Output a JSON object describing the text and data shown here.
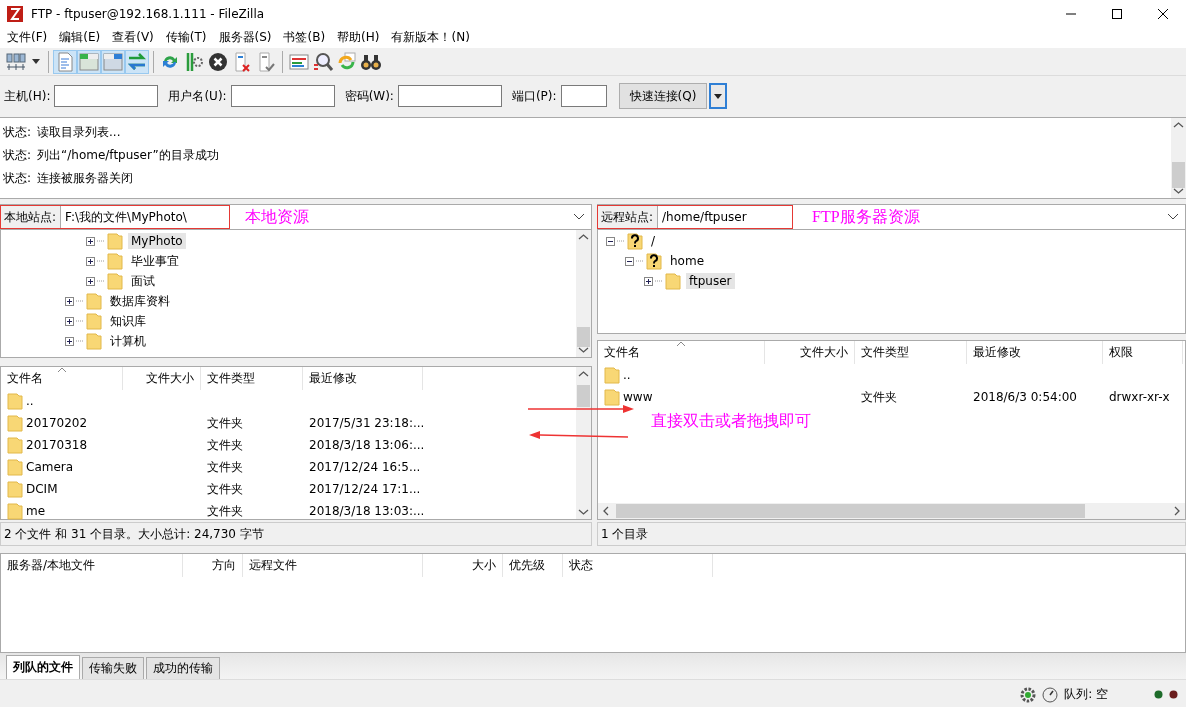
{
  "window": {
    "title": "FTP - ftpuser@192.168.1.111 - FileZilla"
  },
  "menu": [
    "文件(F)",
    "编辑(E)",
    "查看(V)",
    "传输(T)",
    "服务器(S)",
    "书签(B)",
    "帮助(H)",
    "有新版本！(N)"
  ],
  "toolbar": [
    {
      "kind": "site-manager",
      "pressed": false
    },
    {
      "kind": "message-log",
      "pressed": true
    },
    {
      "kind": "local-tree",
      "pressed": true
    },
    {
      "kind": "remote-tree",
      "pressed": true
    },
    {
      "kind": "transfer-queue",
      "pressed": true
    },
    {
      "kind": "refresh",
      "pressed": false
    },
    {
      "kind": "process-queue",
      "pressed": false
    },
    {
      "kind": "cancel",
      "pressed": false
    },
    {
      "kind": "disconnect",
      "pressed": false
    },
    {
      "kind": "reconnect",
      "pressed": false
    },
    {
      "kind": "compare",
      "pressed": false
    },
    {
      "kind": "filter",
      "pressed": false
    },
    {
      "kind": "sync",
      "pressed": false
    },
    {
      "kind": "search",
      "pressed": false
    }
  ],
  "quickconnect": {
    "fields": [
      {
        "label": "主机(H):"
      },
      {
        "label": "用户名(U):"
      },
      {
        "label": "密码(W):"
      },
      {
        "label": "端口(P):"
      }
    ],
    "button": "快速连接(Q)"
  },
  "log": [
    {
      "label": "状态:",
      "text": "读取目录列表..."
    },
    {
      "label": "状态:",
      "text": "列出“/home/ftpuser”的目录成功"
    },
    {
      "label": "状态:",
      "text": "连接被服务器关闭"
    }
  ],
  "local": {
    "site_label": "本地站点:",
    "path": "F:\\我的文件\\MyPhoto\\",
    "annotation": "本地资源",
    "tree": [
      {
        "children": [
          {
            "label": "MyPhoto",
            "kind": "folder",
            "expanded": false,
            "selected": true
          },
          {
            "label": "毕业事宜",
            "kind": "folder",
            "expanded": false,
            "selected": false
          },
          {
            "label": "面试",
            "kind": "folder",
            "expanded": false,
            "selected": false
          }
        ]
      },
      {
        "label": "数据库资料",
        "kind": "folder",
        "expanded": false,
        "selected": false
      },
      {
        "label": "知识库",
        "kind": "folder",
        "expanded": false,
        "selected": false
      },
      {
        "label": "计算机",
        "kind": "folder",
        "expanded": false,
        "selected": false
      }
    ],
    "columns": [
      "文件名",
      "文件大小",
      "文件类型",
      "最近修改"
    ],
    "rows": [
      {
        "name": ".."
      },
      {
        "name": "20170202",
        "type": "文件夹",
        "modified": "2017/5/31 23:18:..."
      },
      {
        "name": "20170318",
        "type": "文件夹",
        "modified": "2018/3/18 13:06:..."
      },
      {
        "name": "Camera",
        "type": "文件夹",
        "modified": "2017/12/24 16:5..."
      },
      {
        "name": "DCIM",
        "type": "文件夹",
        "modified": "2017/12/24 17:1..."
      },
      {
        "name": "me",
        "type": "文件夹",
        "modified": "2018/3/18 13:03:..."
      }
    ],
    "status": "2 个文件 和 31 个目录。大小总计: 24,730 字节"
  },
  "remote": {
    "site_label": "远程站点:",
    "path": "/home/ftpuser",
    "annotation": "FTP服务器资源",
    "tree": [
      {
        "label": "/",
        "kind": "unknown",
        "expanded": true,
        "selected": false,
        "children": [
          {
            "label": "home",
            "kind": "unknown",
            "expanded": true,
            "selected": false,
            "children": [
              {
                "label": "ftpuser",
                "kind": "folder",
                "expanded": false,
                "selected": true
              }
            ]
          }
        ]
      }
    ],
    "columns": [
      "文件名",
      "文件大小",
      "文件类型",
      "最近修改",
      "权限"
    ],
    "rows": [
      {
        "name": ".."
      },
      {
        "name": "www",
        "type": "文件夹",
        "modified": "2018/6/3 0:54:00",
        "permissions": "drwxr-xr-x"
      }
    ],
    "status": "1 个目录"
  },
  "transfer_annotation": "直接双击或者拖拽即可",
  "queue": {
    "columns": [
      "服务器/本地文件",
      "方向",
      "远程文件",
      "大小",
      "优先级",
      "状态"
    ]
  },
  "tabs": [
    {
      "label": "列队的文件",
      "selected": true
    },
    {
      "label": "传输失败",
      "selected": false
    },
    {
      "label": "成功的传输",
      "selected": false
    }
  ],
  "status_bar": {
    "queue": "队列: 空"
  }
}
